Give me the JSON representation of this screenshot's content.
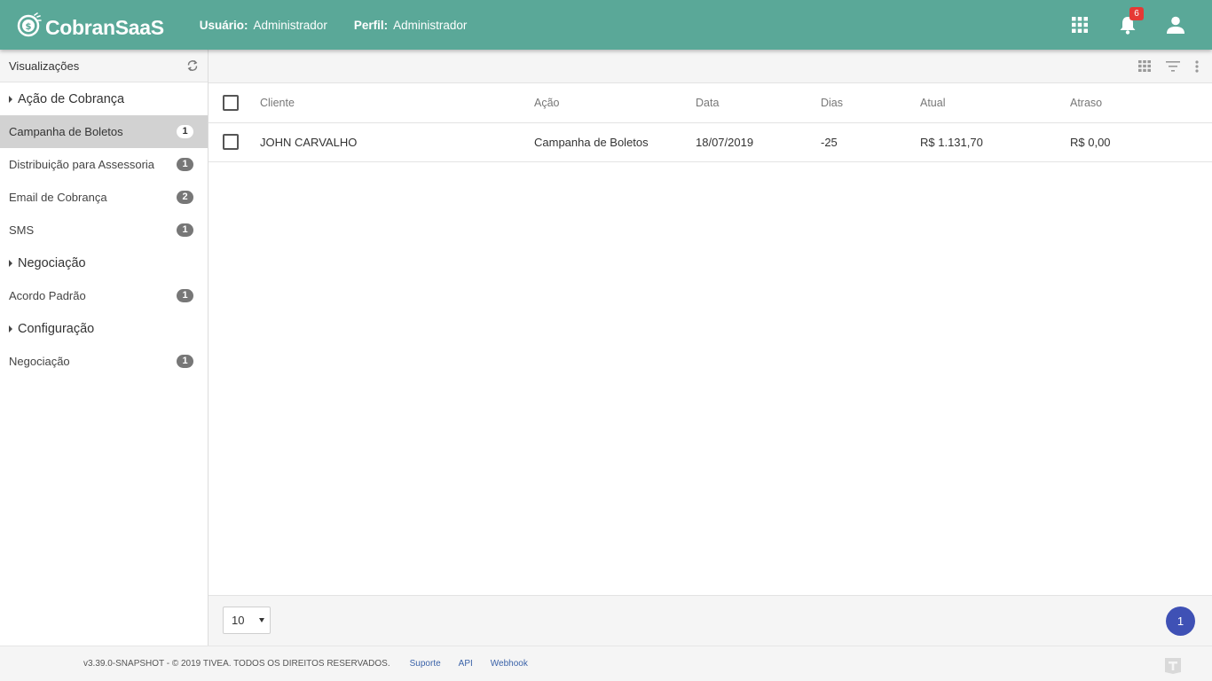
{
  "header": {
    "brand": "CobranSaaS",
    "user_label": "Usuário:",
    "user_value": "Administrador",
    "profile_label": "Perfil:",
    "profile_value": "Administrador",
    "notifications_count": "6",
    "icons": [
      "apps-grid-icon",
      "bell-icon",
      "user-icon"
    ]
  },
  "sidebar": {
    "title": "Visualizações",
    "groups": [
      {
        "label": "Ação de Cobrança",
        "items": [
          {
            "label": "Campanha de Boletos",
            "count": "1",
            "active": true
          },
          {
            "label": "Distribuição para Assessoria",
            "count": "1"
          },
          {
            "label": "Email de Cobrança",
            "count": "2"
          },
          {
            "label": "SMS",
            "count": "1"
          }
        ]
      },
      {
        "label": "Negociação",
        "items": [
          {
            "label": "Acordo Padrão",
            "count": "1"
          }
        ]
      },
      {
        "label": "Configuração",
        "items": [
          {
            "label": "Negociação",
            "count": "1"
          }
        ]
      }
    ]
  },
  "table": {
    "columns": [
      "Cliente",
      "Ação",
      "Data",
      "Dias",
      "Atual",
      "Atraso"
    ],
    "rows": [
      [
        "JOHN CARVALHO",
        "Campanha de Boletos",
        "18/07/2019",
        "-25",
        "R$ 1.131,70",
        "R$ 0,00"
      ]
    ]
  },
  "pager": {
    "page_size": "10",
    "current_page": "1"
  },
  "footer": {
    "copyright": "v3.39.0-SNAPSHOT - © 2019 TIVEA. TODOS OS DIREITOS RESERVADOS.",
    "links": [
      "Suporte",
      "API",
      "Webhook"
    ]
  },
  "colors": {
    "header_bg": "#5aa898",
    "active_item_bg": "#d2d2d2",
    "badge_red": "#e53935",
    "page_button": "#3f51b5"
  }
}
